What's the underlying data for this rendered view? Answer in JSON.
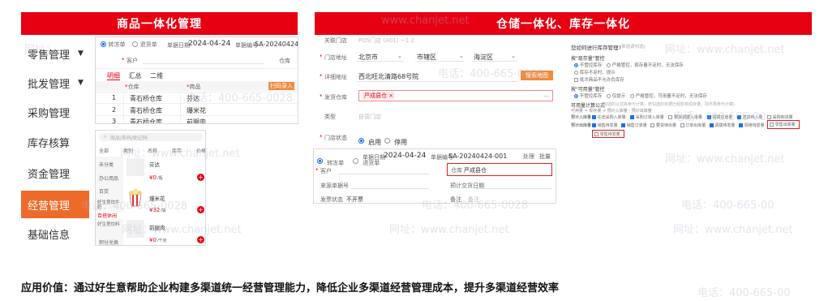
{
  "headers": {
    "left": "商品一体化管理",
    "right": "仓储一体化、库存一体化"
  },
  "menu": {
    "items": [
      {
        "label": "零售管理",
        "caret": "▼"
      },
      {
        "label": "批发管理",
        "caret": "▼"
      },
      {
        "label": "采购管理",
        "caret": ""
      },
      {
        "label": "库存核算",
        "caret": ""
      },
      {
        "label": "资金管理",
        "caret": ""
      },
      {
        "label": "经营管理",
        "caret": ""
      },
      {
        "label": "基础信息",
        "caret": ""
      }
    ]
  },
  "left_form": {
    "radio_on": "转冻单",
    "radio_off": "退货单",
    "date_label": "单据日期",
    "date": "2024-04-24",
    "no_label": "单据编号",
    "no": "SA-20240424-001",
    "customer_label": "客户",
    "warehouse_label": "仓库",
    "tabs": [
      "明细",
      "汇总",
      "二维"
    ],
    "import_btn": "扫码录入",
    "col_warehouse": "仓库",
    "col_goods": "商品",
    "rows": [
      {
        "n": "1",
        "warehouse": "青石桥仓库",
        "goods": "芬达"
      },
      {
        "n": "2",
        "warehouse": "青石桥仓库",
        "goods": "爆米花"
      },
      {
        "n": "3",
        "warehouse": "青石桥仓库",
        "goods": "前腿肉"
      }
    ]
  },
  "mobile": {
    "search_ph": "商品/条码/助记码",
    "tabs": [
      "全部",
      "类别",
      "名称",
      "库存",
      "价格"
    ],
    "categories": [
      "未分类",
      "办公用品",
      "百货",
      "好生意饮牛奶",
      "百搭休闲",
      "好生意饮料",
      "积分兑换"
    ],
    "items": [
      {
        "name": "芬达",
        "price": "¥0",
        "unit": "/瓶"
      },
      {
        "name": "爆米花",
        "price": "¥32",
        "unit": "/袋"
      },
      {
        "name": "前腿肉",
        "price": "¥0",
        "unit": "/千克"
      }
    ]
  },
  "mid_form": {
    "partner_label": "关联门店",
    "partner_value": "POS门店 (A01) ~1.2",
    "region_label": "门店地址",
    "region": [
      "北京市",
      "市辖区",
      "海淀区"
    ],
    "address_label": "详细地址",
    "address": "西北旺北清路68号院",
    "map_btn": "搜索地图",
    "send_label": "发货仓库",
    "send_tag": "严成县仓",
    "type_label": "类型",
    "type_value": "自营门店",
    "status_label": "门店状态",
    "status_on": "启用",
    "status_off": "停用"
  },
  "lower_form": {
    "radio_on": "转冻单",
    "radio_off": "退货单",
    "date_label": "单据日期",
    "date": "2024-04-24",
    "no_label": "单据编号",
    "no": "SA-20240424-001",
    "top_right": [
      "处理",
      "批量"
    ],
    "customer_label": "客户",
    "warehouse_label": "仓库",
    "warehouse_value": "严成县仓",
    "src_label": "来源单据号",
    "delivery_label": "预计交货日期",
    "invoice_label": "发票状态",
    "invoice_value": "不开票",
    "remark_label": "备注",
    "remark_value": "备注"
  },
  "right_settings": {
    "q1": "您如何进行库存管理?",
    "q1_hint": "(单选请勾选)",
    "g1": "按\"现存量\"管控",
    "g1_opts": [
      "不管控库存",
      "严格管控，现存量不足时，无法保存",
      "库存不足时，提示"
    ],
    "g1_extra": "批次商品不允许负库存",
    "g2": "按\"可用量\"管控",
    "g2_opts": [
      "不管控库存",
      "仅提示",
      "严格管控，可用量不足时，无法保存"
    ],
    "formula_label": "可用量计算公式",
    "formula_hint": "(勾选的公式将参与计算，若勾选的单据已经影响现存量，则不再参与计算)",
    "formula_sub": "可用量 = 现存量 + 预计入库量 - 预计出库量",
    "in_label": "预计入库量",
    "in_opts": [
      "在途采购入库量",
      "采购订单入库量",
      "要货调拨入库量",
      "调拨在途量",
      "送货待入量",
      "采购到货量"
    ],
    "out_label": "预计出库量",
    "out_opts": [
      "销售待发量",
      "销售订单量",
      "要货待出量",
      "订单出库量",
      "调拨待发量",
      "领用待发量",
      "零售出库量"
    ],
    "out_extra": "零售待发量"
  },
  "footer": "应用价值：通过好生意帮助企业构建多渠道统一经营管理能力，降低企业多渠道经营管理成本，提升多渠道经营效率",
  "watermarks": {
    "site": "网址：www.chanjet.net",
    "tel": "电话：400-665-0028",
    "site_short": "网址：",
    "site_host": "www.chanjet.net",
    "tel_num": "电话：400-665-00"
  }
}
